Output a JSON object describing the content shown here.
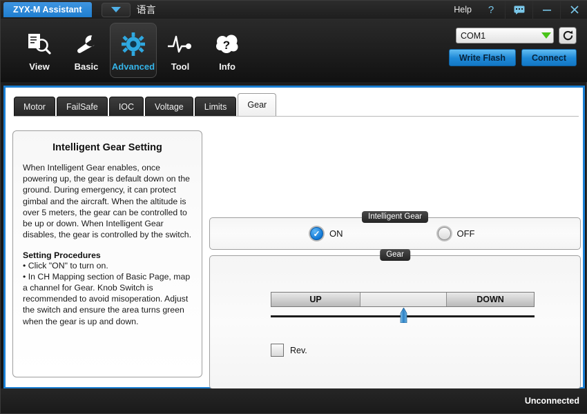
{
  "titlebar": {
    "app_name": "ZYX-M Assistant",
    "language_label": "语言",
    "language_icon": "chevron-down-icon",
    "help_label": "Help",
    "help_icon": "question-mark-icon",
    "message_icon": "message-bubble-icon",
    "minimize_icon": "minimize-icon",
    "close_icon": "close-icon"
  },
  "toolbar": {
    "items": [
      {
        "label": "View",
        "icon": "document-search-icon",
        "active": false
      },
      {
        "label": "Basic",
        "icon": "wrench-icon",
        "active": false
      },
      {
        "label": "Advanced",
        "icon": "gear-icon",
        "active": true
      },
      {
        "label": "Tool",
        "icon": "waveform-icon",
        "active": false
      },
      {
        "label": "Info",
        "icon": "question-cloud-icon",
        "active": false
      }
    ],
    "port_value": "COM1",
    "port_caret_icon": "caret-down-icon",
    "refresh_icon": "refresh-icon",
    "write_flash_label": "Write Flash",
    "connect_label": "Connect"
  },
  "tabs": [
    {
      "label": "Motor",
      "active": false
    },
    {
      "label": "FailSafe",
      "active": false
    },
    {
      "label": "IOC",
      "active": false
    },
    {
      "label": "Voltage",
      "active": false
    },
    {
      "label": "Limits",
      "active": false
    },
    {
      "label": "Gear",
      "active": true
    }
  ],
  "info_panel": {
    "title": "Intelligent Gear Setting",
    "body": "When Intelligent Gear enables, once powering up, the gear is default down on the ground. During emergency, it can protect gimbal and the aircraft. When the altitude is over 5 meters, the gear can be controlled to be up or down. When Intelligent Gear disables, the gear is controlled by the switch.",
    "procedures_title": "Setting Procedures",
    "procedures": [
      "Click \"ON\" to turn on.",
      "In CH Mapping section of Basic Page, map a channel for Gear. Knob Switch is recommended to avoid misoperation. Adjust the switch and ensure the area turns green when the gear is up and down."
    ]
  },
  "intelligent_gear": {
    "group_title": "Intelligent Gear",
    "on_label": "ON",
    "off_label": "OFF",
    "selected": "ON",
    "check_glyph": "✓"
  },
  "gear": {
    "group_title": "Gear",
    "up_label": "UP",
    "middle_label": "",
    "down_label": "DOWN",
    "slider_position_percent": 50,
    "rev_label": "Rev.",
    "rev_checked": false
  },
  "statusbar": {
    "connection_status": "Unconnected"
  },
  "colors": {
    "accent_blue": "#1a7fd4",
    "active_tool_blue": "#35b4e8",
    "radio_on_blue": "#1178d6",
    "combo_caret_green": "#49c319",
    "title_tab_blue": "#2f8ad8"
  }
}
